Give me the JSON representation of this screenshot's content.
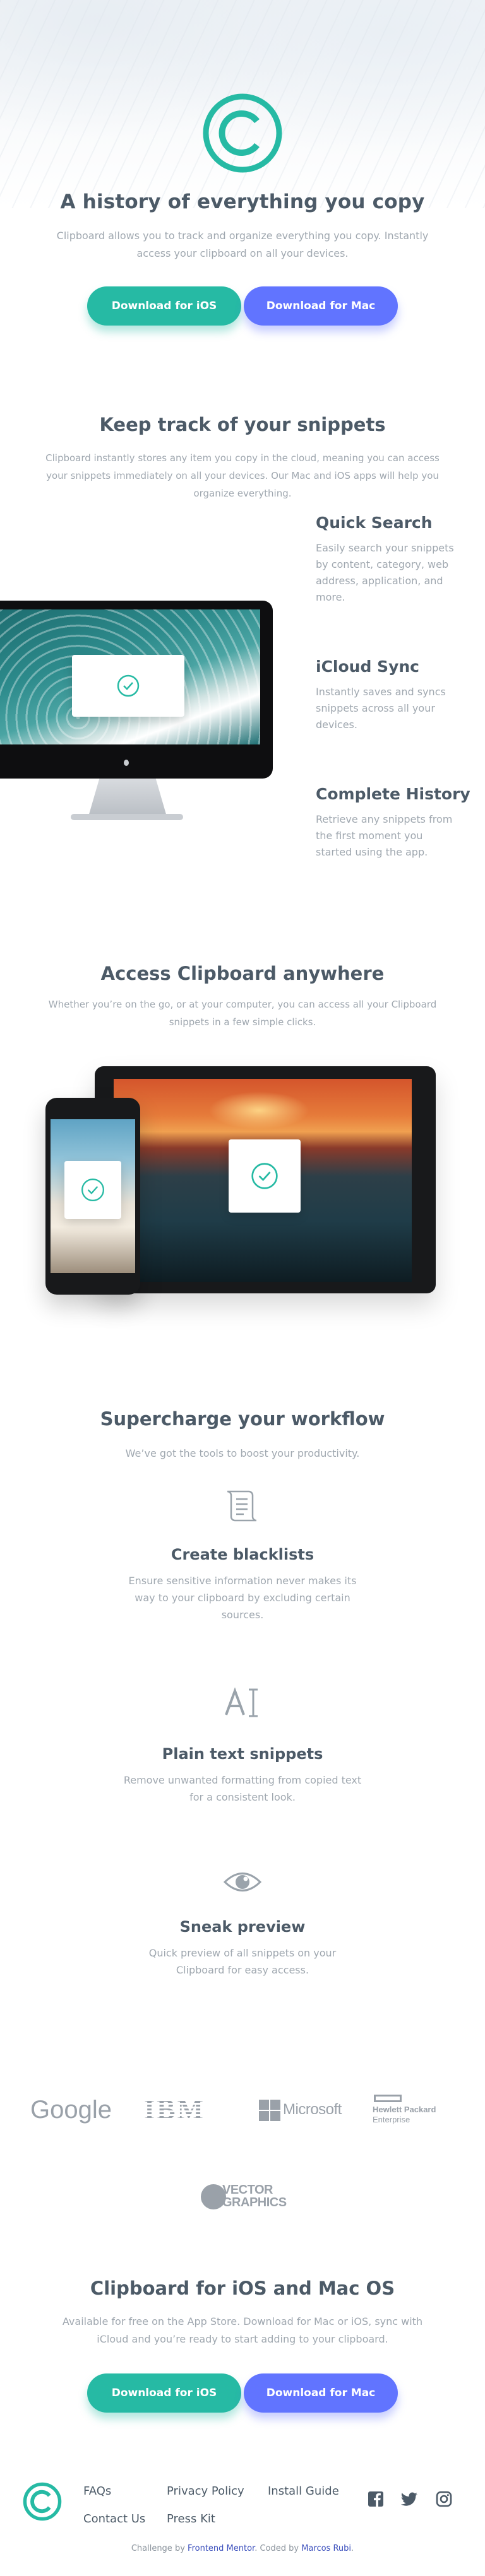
{
  "hero": {
    "title": "A history of everything you copy",
    "lead": "Clipboard allows you to track and organize everything you copy. Instantly access your clipboard on all your devices.",
    "buttons": {
      "ios": "Download for iOS",
      "mac": "Download for Mac"
    }
  },
  "snippets": {
    "title": "Keep track of your snippets",
    "lead": "Clipboard instantly stores any item you copy in the cloud, meaning you can access your snippets immediately on all your devices. Our Mac and iOS apps will help you organize everything.",
    "features": [
      {
        "title": "Quick Search",
        "text": "Easily search your snippets by content, category, web address, application, and more."
      },
      {
        "title": "iCloud Sync",
        "text": "Instantly saves and syncs snippets across all your devices."
      },
      {
        "title": "Complete History",
        "text": "Retrieve any snippets from the first moment you started using the app."
      }
    ]
  },
  "access": {
    "title": "Access Clipboard anywhere",
    "lead": "Whether you’re on the go, or at your computer, you can access all your Clipboard snippets in a few simple clicks."
  },
  "workflow": {
    "title": "Supercharge your workflow",
    "lead": "We’ve got the tools to boost your productivity.",
    "items": [
      {
        "icon": "blacklist-icon",
        "title": "Create blacklists",
        "text": "Ensure sensitive information never makes its way to your clipboard by excluding certain sources."
      },
      {
        "icon": "text-icon",
        "title": "Plain text snippets",
        "text": "Remove unwanted formatting from copied text for a consistent look."
      },
      {
        "icon": "preview-icon",
        "title": "Sneak preview",
        "text": "Quick preview of all snippets on your Clipboard for easy access."
      }
    ]
  },
  "partners": {
    "google": "Google",
    "ibm": "IBM",
    "microsoft": "Microsoft",
    "hp_line1": "Hewlett Packard",
    "hp_line2": "Enterprise",
    "vector_line1": "VECTOR",
    "vector_line2": "GRAPHICS"
  },
  "cta": {
    "title": "Clipboard for iOS and Mac OS",
    "lead": "Available for free on the App Store. Download for Mac or iOS, sync with iCloud and you’re ready to start adding to your clipboard.",
    "buttons": {
      "ios": "Download for iOS",
      "mac": "Download for Mac"
    }
  },
  "footer": {
    "links": [
      "FAQs",
      "Contact Us",
      "Privacy Policy",
      "Press Kit",
      "Install Guide"
    ],
    "social": [
      "facebook-icon",
      "twitter-icon",
      "instagram-icon"
    ],
    "credit": {
      "prefix": "Challenge by",
      "mentor": "Frontend Mentor",
      "middle": ". Coded by",
      "author": "Marcos Rubi",
      "suffix": "."
    }
  },
  "colors": {
    "accent_teal": "#26baa4",
    "accent_blue": "#6174ff",
    "heading": "#4c5a67",
    "body": "#a0a8b0"
  }
}
